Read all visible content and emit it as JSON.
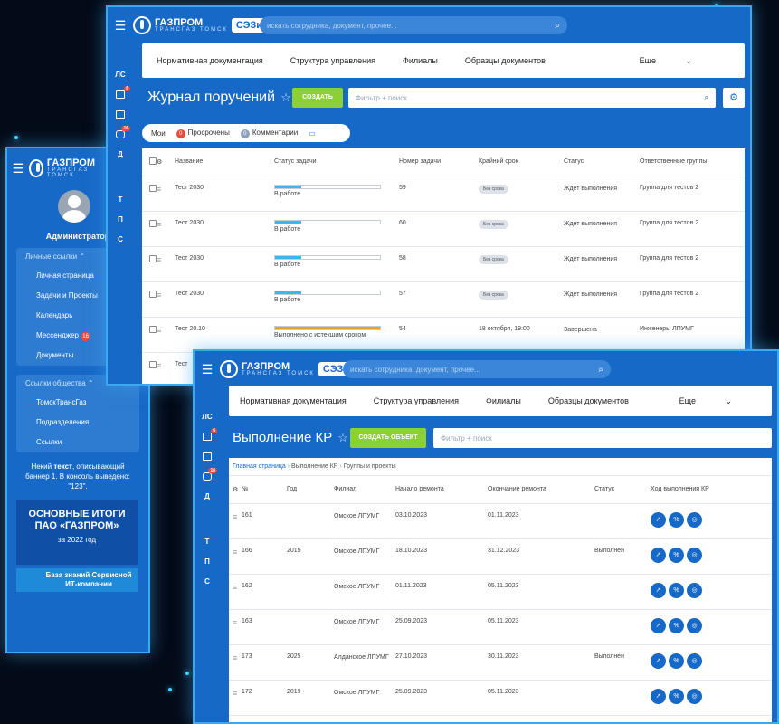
{
  "brand": {
    "name": "ГАЗПРОМ",
    "sub": "ТРАНСГАЗ ТОМСК",
    "badge": "СЭЗиС"
  },
  "search_placeholder": "искать сотрудника, документ, прочее...",
  "sidebar": {
    "user": "Администратор",
    "personal_links_title": "Личные ссылки",
    "personal_links": [
      "Личная страница",
      "Задачи и Проекты",
      "Календарь",
      "Мессенджер",
      "Документы"
    ],
    "messenger_badge": "16",
    "common_links_title": "Ссылки общества",
    "common_links": [
      "ТомскТрансГаз",
      "Подразделения",
      "Ссылки"
    ],
    "banner_text": [
      "Некий",
      "текст",
      ", описывающий баннер 1. В консоль выведено: \"123\"."
    ],
    "promo_title": "ОСНОВНЫЕ ИТОГИ ПАО «ГАЗПРОМ»",
    "promo_year": "за 2022 год",
    "kb_text": "База знаний Сервисной ИТ-компании"
  },
  "rail": {
    "ls": "ЛС",
    "d": "Д",
    "t": "Т",
    "p": "П",
    "s": "С",
    "badge_red": "6",
    "badge_red2": "16"
  },
  "nav": {
    "items": [
      "Нормативная документация",
      "Структура управления",
      "Филиалы",
      "Образцы документов"
    ],
    "more": "Еще"
  },
  "journal": {
    "title": "Журнал поручений",
    "create": "СОЗДАТЬ",
    "filter": "Фильтр + поиск",
    "tabs": {
      "mine": "Мои",
      "overdue_count": "0",
      "overdue": "Просрочены",
      "comments_count": "0",
      "comments": "Комментарии"
    },
    "columns": [
      "Название",
      "Статус задачи",
      "Номер задачи",
      "Крайний срок",
      "Статус",
      "Ответственные группы"
    ],
    "rows": [
      {
        "name": "Тест 2030",
        "status": "В работе",
        "progress": 0.25,
        "number": "59",
        "deadline": "Без срока",
        "state": "Ждет выполнения",
        "group": "Группа для тестов 2"
      },
      {
        "name": "Тест 2030",
        "status": "В работе",
        "progress": 0.25,
        "number": "60",
        "deadline": "Без срока",
        "state": "Ждет выполнения",
        "group": "Группа для тестов 2"
      },
      {
        "name": "Тест 2030",
        "status": "В работе",
        "progress": 0.25,
        "number": "58",
        "deadline": "Без срока",
        "state": "Ждет выполнения",
        "group": "Группа для тестов 2"
      },
      {
        "name": "Тест 2030",
        "status": "В работе",
        "progress": 0.25,
        "number": "57",
        "deadline": "Без срока",
        "state": "Ждет выполнения",
        "group": "Группа для тестов 2"
      },
      {
        "name": "Тест 20.10",
        "status": "Выполнено с истекшим сроком",
        "progress": 1.0,
        "number": "54",
        "deadline": "18 октября, 19:00",
        "state": "Завершена",
        "group": "Инженеры ЛПУМГ"
      },
      {
        "name": "Тест",
        "status": "",
        "progress": 0,
        "number": "",
        "deadline": "",
        "state": "",
        "group": ""
      }
    ]
  },
  "kr": {
    "title": "Выполнение КР",
    "create": "СОЗДАТЬ ОБЪЕКТ",
    "filter": "Фильтр + поиск",
    "breadcrumb": [
      "Главная страница",
      "Выполнение КР",
      "Группы и проекты"
    ],
    "columns": [
      "№",
      "Год",
      "Филиал",
      "Начало ремонта",
      "Окончание ремонта",
      "Статус",
      "Ход выполнения КР"
    ],
    "rows": [
      {
        "num": "161",
        "year": "",
        "branch": "Омское ЛПУМГ",
        "start": "03.10.2023",
        "end": "01.11.2023",
        "status": ""
      },
      {
        "num": "166",
        "year": "2015",
        "branch": "Омское ЛПУМГ",
        "start": "18.10.2023",
        "end": "31.12.2023",
        "status": "Выполнен"
      },
      {
        "num": "162",
        "year": "",
        "branch": "Омское ЛПУМГ",
        "start": "01.11.2023",
        "end": "05.11.2023",
        "status": ""
      },
      {
        "num": "163",
        "year": "",
        "branch": "Омское ЛПУМГ",
        "start": "25.09.2023",
        "end": "05.11.2023",
        "status": ""
      },
      {
        "num": "173",
        "year": "2025",
        "branch": "Алданское ЛПУМГ",
        "start": "27.10.2023",
        "end": "30.11.2023",
        "status": "Выполнен"
      },
      {
        "num": "172",
        "year": "2019",
        "branch": "Омское ЛПУМГ",
        "start": "25.09.2023",
        "end": "05.11.2023",
        "status": ""
      }
    ]
  }
}
